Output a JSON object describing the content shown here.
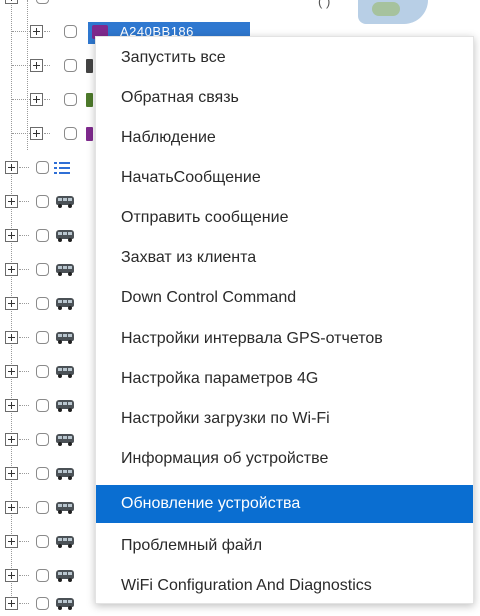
{
  "tree": {
    "selected_node_label": "A240BB186",
    "top_glyph": "( )"
  },
  "menu": {
    "items": [
      {
        "label": "Запустить все",
        "active": false
      },
      {
        "label": "Обратная связь",
        "active": false
      },
      {
        "label": "Наблюдение",
        "active": false
      },
      {
        "label": "НачатьСообщение",
        "active": false
      },
      {
        "label": "Отправить сообщение",
        "active": false
      },
      {
        "label": "Захват из клиента",
        "active": false
      },
      {
        "label": "Down Control Command",
        "active": false
      },
      {
        "label": "Настройки интервала GPS-отчетов",
        "active": false
      },
      {
        "label": "Настройка параметров 4G",
        "active": false
      },
      {
        "label": "Настройки загрузки по Wi-Fi",
        "active": false
      },
      {
        "label": "Информация об устройстве",
        "active": false
      },
      {
        "label": "Обновление устройства",
        "active": true
      },
      {
        "label": "Проблемный файл",
        "active": false
      },
      {
        "label": "WiFi Configuration And Diagnostics",
        "active": false
      }
    ]
  },
  "colors": {
    "highlight": "#0a6ed1",
    "text": "#2a2a2a",
    "tree_selection": "#2f78d0"
  }
}
